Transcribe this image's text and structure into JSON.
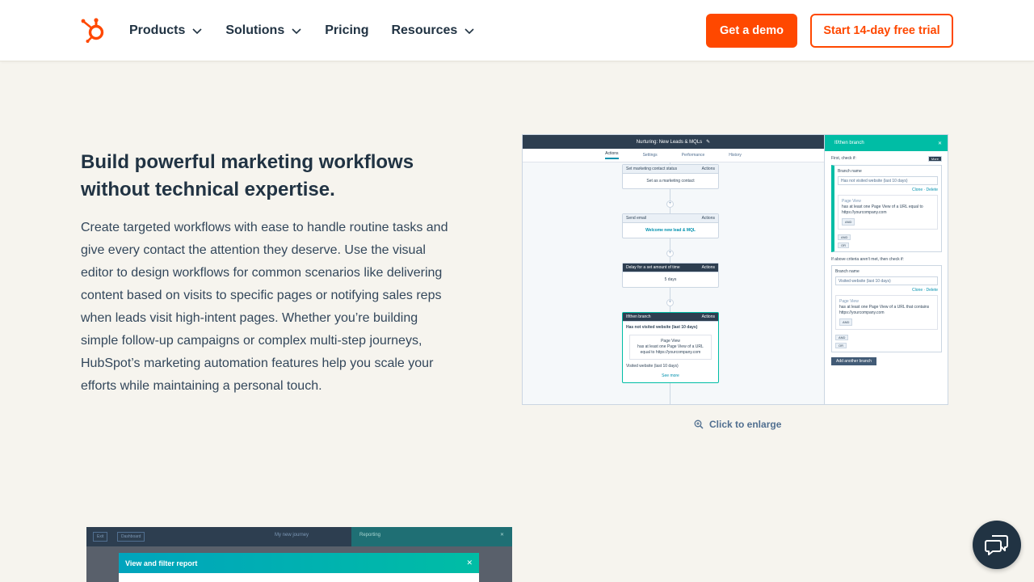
{
  "header": {
    "logo_icon": "hubspot-sprocket-icon",
    "nav": [
      {
        "label": "Products",
        "has_dropdown": true
      },
      {
        "label": "Solutions",
        "has_dropdown": true
      },
      {
        "label": "Pricing",
        "has_dropdown": false
      },
      {
        "label": "Resources",
        "has_dropdown": true
      }
    ],
    "demo_button": "Get a demo",
    "trial_button": "Start 14-day free trial"
  },
  "content": {
    "heading": "Build powerful marketing workflows without technical expertise.",
    "paragraph": "Create targeted workflows with ease to handle routine tasks and give every contact the attention they deserve. Use the visual editor to design workflows for common scenarios like delivering content based on visits to specific pages or notifying sales reps when leads visit high-intent pages. Whether you’re building simple follow-up campaigns or complex multi-step journeys, HubSpot’s marketing automation features help you scale your efforts while maintaining a personal touch."
  },
  "workflow_screenshot": {
    "title": "Nurturing: New Leads & MQLs",
    "tabs": [
      "Actions",
      "Settings",
      "Performance",
      "History"
    ],
    "cards": [
      {
        "header": "Set marketing contact status",
        "actions": "Actions",
        "body": "Set as a marketing contact"
      },
      {
        "header": "Send email",
        "actions": "Actions",
        "body": "Welcome new lead & MQL"
      },
      {
        "header": "Delay for a set amount of time",
        "actions": "Actions",
        "body": "5 days"
      },
      {
        "header": "If/then branch",
        "actions": "Actions",
        "body": "Has not visited website (last 10 days)"
      }
    ],
    "branch_filter": {
      "title": "Page View",
      "text": "has at least one Page View of a URL equal to https://yourcompany.com"
    },
    "branch_other": "Visited website (last 10 days)",
    "see_more": "See more",
    "panel": {
      "title": "If/then branch",
      "first_check": "First, check if:",
      "more": "More",
      "branch_name_label": "Branch name",
      "branch_1_value": "Has not visited website (last 10 days)",
      "clone_delete": "Clone · Delete",
      "filter_1_title": "Page View",
      "filter_1_text": "has at least one Page View of a URL equal to https://yourcompany.com",
      "and_label": "AND",
      "or_label": "OR",
      "second_check": "If above criteria aren't met, then check if:",
      "branch_2_value": "Visited website (last 10 days)",
      "filter_2_text": "has at least one Page View of a URL that contains https://yourcompany.com",
      "add_branch": "Add another branch"
    }
  },
  "enlarge": {
    "icon": "zoom-in-icon",
    "label": "Click to enlarge"
  },
  "second_screenshot": {
    "chip_1": "Exit",
    "chip_2": "Dashboard",
    "journey_title": "My new journey",
    "right_panel": "Reporting",
    "modal_title": "View and filter report"
  },
  "chat": {
    "icon": "chat-bubbles-icon"
  },
  "colors": {
    "brand_orange": "#ff4800",
    "navy": "#213343",
    "teal": "#00bda5",
    "background": "#f6f4ee"
  }
}
